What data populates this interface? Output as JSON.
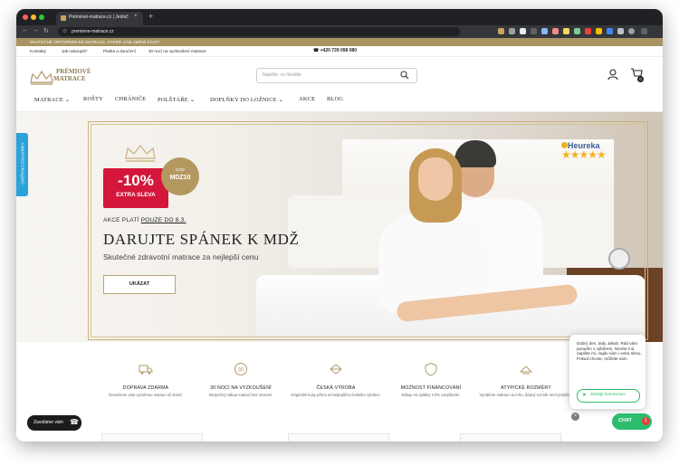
{
  "browser": {
    "tab_title": "Prémiové-matrace.cz | Jednič...",
    "tab_close": "×",
    "new_tab": "+",
    "url": "premiove-matrace.cz",
    "back_icon": "←",
    "forward_icon": "→",
    "reload_icon": "↻",
    "lock_icon": "⊙"
  },
  "promo_bar": {
    "text": "SKUTEČNĚ ORTOPEDICKÉ MATRACE, KTERÉ VÁM ZMĚNÍ ŽIVOT"
  },
  "top_links": {
    "items": [
      "Kontakty",
      "Jak nakoupit?",
      "Platba a doručení",
      "30 nocí na vyzkoušení matrace"
    ],
    "phone": "+420 739 098 080"
  },
  "logo": {
    "line1": "PRÉMIOVÉ",
    "line2": "MATRACE"
  },
  "search": {
    "placeholder": "Napište, co hledáte"
  },
  "cart": {
    "count": "0"
  },
  "menu": {
    "items": [
      "MATRACE",
      "ROŠTY",
      "CHRÁNIČE",
      "POLŠTÁŘE",
      "DOPLŇKY DO LOŽNICE",
      "AKCE",
      "BLOG"
    ],
    "chevron": "⌄"
  },
  "hero": {
    "discount": "-10%",
    "extra": "EXTRA SLEVA",
    "code_label": "KÓD",
    "code": "MDZ10",
    "valid_prefix": "AKCE PLATÍ",
    "valid_bold": "POUZE DO 8.3.",
    "title": "DARUJTE SPÁNEK K MDŽ",
    "subtitle": "Skutečné zdravotní matrace za nejlepší cenu",
    "button": "UKÁZAT",
    "heureka": "Heureka",
    "stars": "★★★★★",
    "side_tab": "OVĚŘENO ZÁKAZNÍKY"
  },
  "features": [
    {
      "title": "DOPRAVA ZDARMA",
      "desc": "Dovezeme vám vysněnou matraci až domů."
    },
    {
      "title": "30 NOCÍ NA VYZKOUŠENÍ",
      "desc": "Bezpečný nákup matrací bez starostí."
    },
    {
      "title": "ČESKÁ VÝROBA",
      "desc": "Originální kusy přímo od nejlepšího českého výrobce."
    },
    {
      "title": "MOŽNOST FINANCOVÁNÍ",
      "desc": "Nákup na splátky s 0% navýšením."
    },
    {
      "title": "ATYPICKÉ ROZMĚRY",
      "desc": "Vyrobíme matraci na míru. Žádný rozměr není problém."
    }
  ],
  "callback": {
    "label": "Zavoláme vám",
    "icon": "☎"
  },
  "chat": {
    "message": "Dobrý den, tady Jakub. Rád vám poradím s výběrem. Nevíte-li si, napište mi, najdu vám i extra slevu. Pokud chcete, můžete nám",
    "start": "Zahájit konverzaci",
    "close": "×",
    "bubble": "CHAT",
    "badge": "1"
  },
  "colors": {
    "gold": "#a89362",
    "red": "#d4163a",
    "green": "#2bbd6d",
    "tab_blue": "#2aa2da"
  }
}
